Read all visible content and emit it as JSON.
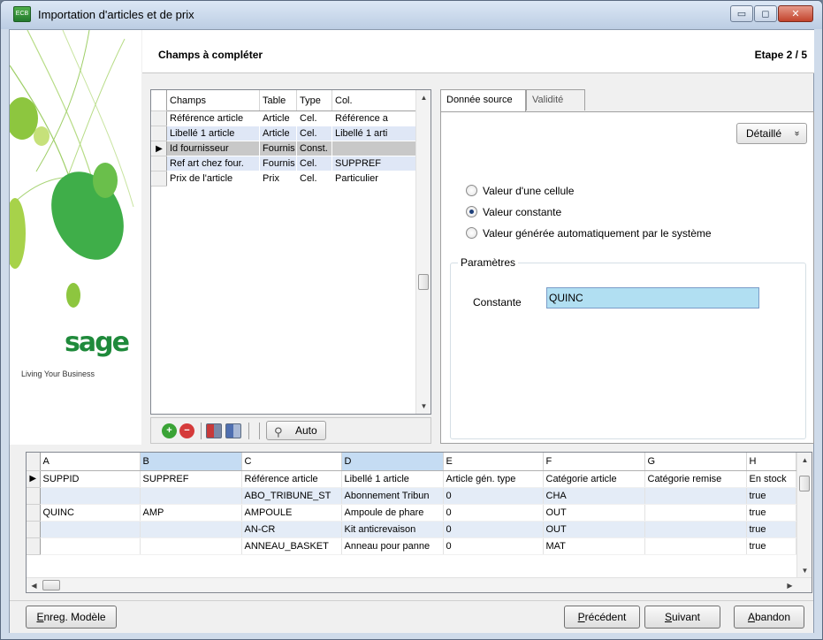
{
  "window": {
    "title": "Importation d'articles et de prix",
    "app_icon_text": "ECB",
    "minimize_glyph": "▭",
    "maximize_glyph": "◻",
    "close_glyph": "✕"
  },
  "branding": {
    "logo_text": "sage",
    "tagline": "Living Your Business"
  },
  "header": {
    "title": "Champs à compléter",
    "step": "Etape  2 / 5"
  },
  "fields_grid": {
    "columns": [
      "Champs",
      "Table",
      "Type",
      "Col."
    ],
    "rows": [
      {
        "champs": "Référence article",
        "table": "Article",
        "type": "Cel.",
        "col": "Référence a"
      },
      {
        "champs": "Libellé 1 article",
        "table": "Article",
        "type": "Cel.",
        "col": "Libellé 1 arti"
      },
      {
        "champs": "Id fournisseur",
        "table": "Fournis",
        "type": "Const.",
        "col": ""
      },
      {
        "champs": "Ref art chez four.",
        "table": "Fournis",
        "type": "Cel.",
        "col": "SUPPREF"
      },
      {
        "champs": "Prix de l'article",
        "table": "Prix",
        "type": "Cel.",
        "col": "Particulier"
      }
    ],
    "current_row_marker": "▶"
  },
  "mini_toolbar": {
    "add_glyph": "+",
    "remove_glyph": "−",
    "auto_label": "Auto",
    "auto_icon_glyph": "⚲"
  },
  "tabs": {
    "active": "Donnée source",
    "items": [
      "Donnée source",
      "Validité"
    ]
  },
  "source_panel": {
    "detail_button": "Détaillé",
    "detail_chevron": "»",
    "radios": [
      {
        "label": "Valeur d'une cellule",
        "checked": false
      },
      {
        "label": "Valeur constante",
        "checked": true
      },
      {
        "label": "Valeur générée automatiquement par le système",
        "checked": false
      }
    ],
    "params_title": "Paramètres",
    "constant_label": "Constante",
    "constant_value": "QUINC"
  },
  "data_grid": {
    "columns": [
      "A",
      "B",
      "C",
      "D",
      "E",
      "F",
      "G",
      "H"
    ],
    "highlighted_columns": [
      "B",
      "D"
    ],
    "rows": [
      [
        "SUPPID",
        "SUPPREF",
        "Référence article",
        "Libellé 1 article",
        "Article gén. type",
        "Catégorie article",
        "Catégorie remise",
        "En stock"
      ],
      [
        "",
        "",
        "ABO_TRIBUNE_ST",
        "Abonnement Tribun",
        "0",
        "CHA",
        "",
        "true"
      ],
      [
        "QUINC",
        "AMP",
        "AMPOULE",
        "Ampoule de phare",
        "0",
        "OUT",
        "",
        "true"
      ],
      [
        "",
        "",
        "AN-CR",
        "Kit anticrevaison",
        "0",
        "OUT",
        "",
        "true"
      ],
      [
        "",
        "",
        "ANNEAU_BASKET",
        "Anneau pour panne",
        "0",
        "MAT",
        "",
        "true"
      ]
    ],
    "current_row_marker": "▶"
  },
  "buttons": {
    "save_model": {
      "underline": "E",
      "rest": "nreg. Modèle"
    },
    "previous": {
      "underline": "P",
      "rest": "récédent"
    },
    "next": {
      "underline": "S",
      "rest": "uivant"
    },
    "cancel": {
      "underline": "A",
      "rest": "bandon"
    }
  },
  "colors": {
    "sage_green": "#1f8a3b",
    "selection_gray": "#c8c8c8",
    "input_highlight": "#b1dff2",
    "row_alt_blue": "#dfe7f6"
  }
}
